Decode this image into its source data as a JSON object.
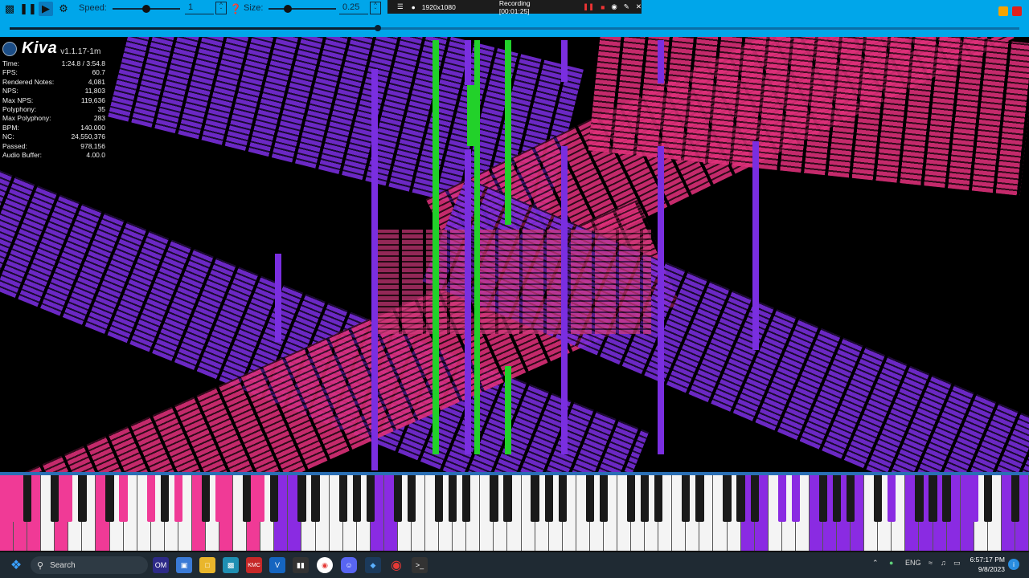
{
  "toolbar": {
    "speed_label": "Speed:",
    "speed_value": "1",
    "size_label": "Size:",
    "size_value": "0.25",
    "seek_progress": 0.365
  },
  "recorder": {
    "resolution": "1920x1080",
    "status": "Recording [00:01:25]"
  },
  "app": {
    "name": "Kiva",
    "version": "v1.1.17-1m"
  },
  "stats": [
    {
      "label": "Time:",
      "value": "1:24.8 / 3:54.8"
    },
    {
      "label": "FPS:",
      "value": "60.7"
    },
    {
      "label": "Rendered Notes:",
      "value": "4,081"
    },
    {
      "label": "NPS:",
      "value": "11,803"
    },
    {
      "label": "Max NPS:",
      "value": "119,636"
    },
    {
      "label": "Polyphony:",
      "value": "35"
    },
    {
      "label": "Max Polyphony:",
      "value": "283"
    },
    {
      "label": "BPM:",
      "value": "140.000"
    },
    {
      "label": "NC:",
      "value": "24,550,376"
    },
    {
      "label": "Passed:",
      "value": "978,156"
    },
    {
      "label": "Audio Buffer:",
      "value": "4.00.0"
    }
  ],
  "colors": {
    "toolbar": "#00a6ea",
    "pink": "#e0307a",
    "purple": "#7a2ee0",
    "green": "#22d12a",
    "pressed_pink": "#f03a96",
    "pressed_purple": "#8a2be2"
  },
  "taskbar": {
    "search_label": "Search",
    "om_label": "OM",
    "kmc_label": "KMC",
    "v_label": "V",
    "lang": "ENG",
    "time": "6:57:17 PM",
    "date": "9/8/2023"
  }
}
